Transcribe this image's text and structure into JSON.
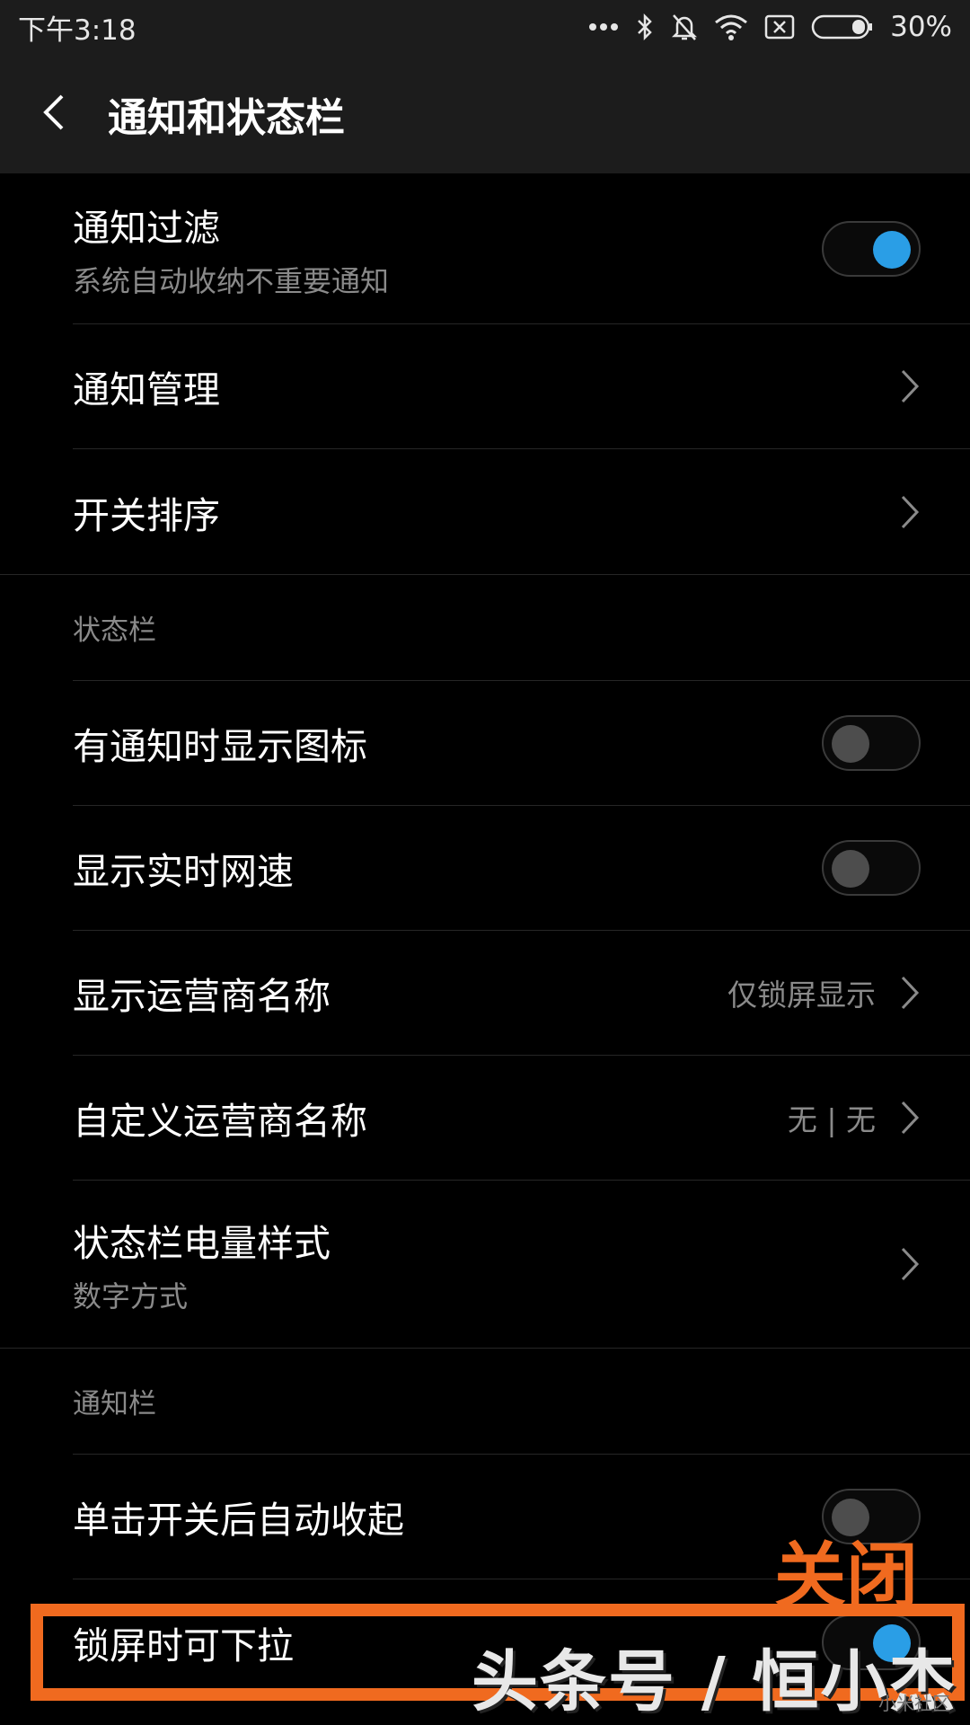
{
  "status_bar": {
    "time": "下午3:18",
    "battery": "30%"
  },
  "header": {
    "title": "通知和状态栏"
  },
  "top_rows": [
    {
      "title": "通知过滤",
      "subtitle": "系统自动收纳不重要通知",
      "control": "toggle",
      "on": true
    },
    {
      "title": "通知管理",
      "control": "chevron"
    },
    {
      "title": "开关排序",
      "control": "chevron"
    }
  ],
  "sections": {
    "status_bar_label": "状态栏",
    "notification_bar_label": "通知栏"
  },
  "status_rows": [
    {
      "title": "有通知时显示图标",
      "control": "toggle",
      "on": false
    },
    {
      "title": "显示实时网速",
      "control": "toggle",
      "on": false
    },
    {
      "title": "显示运营商名称",
      "value": "仅锁屏显示",
      "control": "chevron"
    },
    {
      "title": "自定义运营商名称",
      "value": "无 | 无",
      "control": "chevron"
    },
    {
      "title": "状态栏电量样式",
      "subtitle": "数字方式",
      "control": "chevron"
    }
  ],
  "notif_rows": [
    {
      "title": "单击开关后自动收起",
      "control": "toggle",
      "on": false
    },
    {
      "title": "锁屏时可下拉",
      "control": "toggle",
      "on": true
    }
  ],
  "annotation": {
    "label": "关闭",
    "color": "#f06a1f"
  },
  "watermark": {
    "text": "头条号 / 恒小杰",
    "corner": "小米社区"
  }
}
